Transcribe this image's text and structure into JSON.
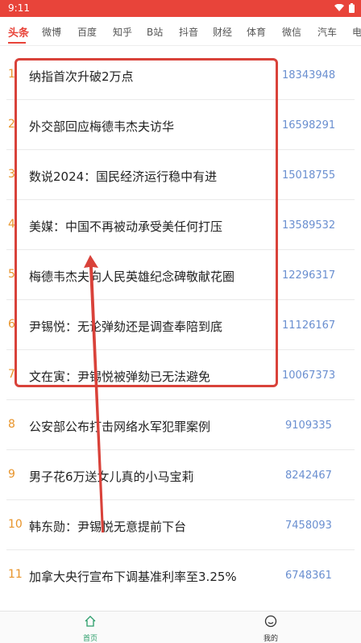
{
  "status": {
    "time": "9:11"
  },
  "tabs": [
    {
      "label": "头条"
    },
    {
      "label": "微博"
    },
    {
      "label": "百度"
    },
    {
      "label": "知乎"
    },
    {
      "label": "B站"
    },
    {
      "label": "抖音"
    },
    {
      "label": "财经"
    },
    {
      "label": "体育"
    },
    {
      "label": "微信"
    },
    {
      "label": "汽车"
    },
    {
      "label": "电"
    }
  ],
  "list": [
    {
      "rank": "1",
      "title": "纳指首次升破2万点",
      "count": "18343948"
    },
    {
      "rank": "2",
      "title": "外交部回应梅德韦杰夫访华",
      "count": "16598291"
    },
    {
      "rank": "3",
      "title": "数说2024：国民经济运行稳中有进",
      "count": "15018755"
    },
    {
      "rank": "4",
      "title": "美媒：中国不再被动承受美任何打压",
      "count": "13589532"
    },
    {
      "rank": "5",
      "title": "梅德韦杰夫向人民英雄纪念碑敬献花圈",
      "count": "12296317"
    },
    {
      "rank": "6",
      "title": "尹锡悦：无论弹劾还是调查奉陪到底",
      "count": "11126167"
    },
    {
      "rank": "7",
      "title": "文在寅：尹锡悦被弹劾已无法避免",
      "count": "10067373"
    },
    {
      "rank": "8",
      "title": "公安部公布打击网络水军犯罪案例",
      "count": "9109335"
    },
    {
      "rank": "9",
      "title": "男子花6万送女儿真的小马宝莉",
      "count": "8242467"
    },
    {
      "rank": "10",
      "title": "韩东勋：尹锡悦无意提前下台",
      "count": "7458093"
    },
    {
      "rank": "11",
      "title": "加拿大央行宣布下调基准利率至3.25%",
      "count": "6748361"
    }
  ],
  "nav": {
    "home": "首页",
    "mine": "我的"
  },
  "colors": {
    "accent": "#e8443a",
    "rank": "#e8942a",
    "count": "#6a8fd0",
    "annotation": "#d9423a"
  }
}
